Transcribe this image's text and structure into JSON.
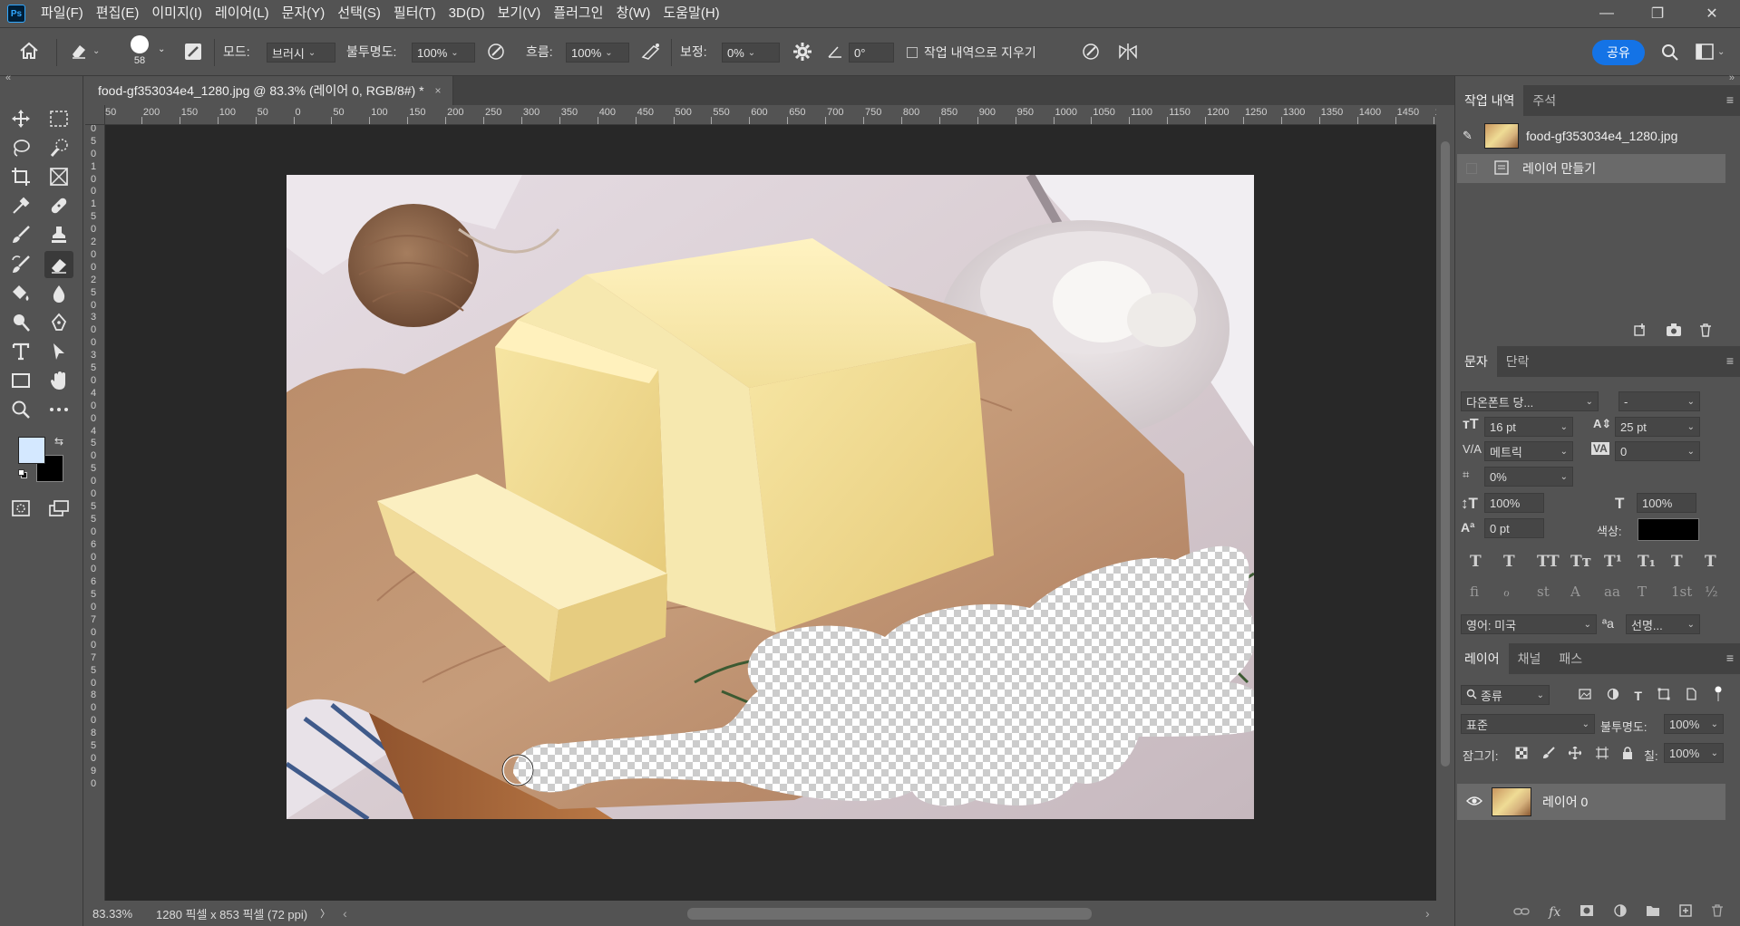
{
  "app": {
    "logo": "Ps"
  },
  "menu": [
    "파일(F)",
    "편집(E)",
    "이미지(I)",
    "레이어(L)",
    "문자(Y)",
    "선택(S)",
    "필터(T)",
    "3D(D)",
    "보기(V)",
    "플러그인",
    "창(W)",
    "도움말(H)"
  ],
  "window_controls": {
    "minimize": "—",
    "restore": "❐",
    "close": "✕"
  },
  "options": {
    "brush_size": "58",
    "mode_label": "모드:",
    "mode_value": "브러시",
    "opacity_label": "불투명도:",
    "opacity_value": "100%",
    "flow_label": "흐름:",
    "flow_value": "100%",
    "smoothing_label": "보정:",
    "smoothing_value": "0%",
    "angle_value": "0°",
    "erase_history_label": "작업 내역으로 지우기",
    "share_label": "공유"
  },
  "document": {
    "tab_title": "food-gf353034e4_1280.jpg @ 83.3% (레이어 0, RGB/8#) *",
    "close_glyph": "×"
  },
  "ruler": {
    "h_labels": [
      "50",
      "200",
      "150",
      "100",
      "50",
      "0",
      "50",
      "100",
      "150",
      "200",
      "250",
      "300",
      "350",
      "400",
      "450",
      "500",
      "550",
      "600",
      "650",
      "700",
      "750",
      "800",
      "850",
      "900",
      "950",
      "1000",
      "1050",
      "1100",
      "1150",
      "1200",
      "1250",
      "1300",
      "1350",
      "1400",
      "1450",
      "150"
    ],
    "v_labels": [
      "5",
      "0",
      "5",
      "0",
      "1",
      "0",
      "0",
      "1",
      "5",
      "0",
      "2",
      "0",
      "0",
      "2",
      "5",
      "0",
      "3",
      "0",
      "0",
      "3",
      "5",
      "0",
      "4",
      "0",
      "0",
      "4",
      "5",
      "0",
      "5",
      "0",
      "0",
      "5",
      "5",
      "0",
      "6",
      "0",
      "0",
      "6",
      "5",
      "0",
      "7",
      "0",
      "0",
      "7",
      "5",
      "0",
      "8",
      "0",
      "0",
      "8",
      "5",
      "0",
      "9",
      "0"
    ]
  },
  "status": {
    "zoom": "83.33%",
    "dimensions": "1280 픽셀 x 853 픽셀 (72 ppi)",
    "arrow": "〉",
    "scroll_left": "‹",
    "scroll_right": "›"
  },
  "history_panel": {
    "tabs": [
      "작업 내역",
      "주석"
    ],
    "items": [
      "food-gf353034e4_1280.jpg",
      "레이어 만들기"
    ]
  },
  "character_panel": {
    "tabs": [
      "문자",
      "단락"
    ],
    "font_family": "다온폰트 당...",
    "font_style": "-",
    "font_size": "16 pt",
    "leading": "25 pt",
    "kerning": "메트릭",
    "tracking": "0",
    "tsume": "0%",
    "vertical_scale": "100%",
    "horizontal_scale": "100%",
    "baseline_shift": "0 pt",
    "color_label": "색상:",
    "color_value": "#000000",
    "type_buttons": [
      "T",
      "T",
      "TT",
      "Tт",
      "T¹",
      "T₁",
      "T",
      "T"
    ],
    "opentype_buttons": [
      "ﬁ",
      "ℴ",
      "st",
      "A",
      "aa",
      "T",
      "1st",
      "½"
    ],
    "language": "영어: 미국",
    "aa_label": "ªa",
    "antialias": "선명..."
  },
  "layers_panel": {
    "tabs": [
      "레이어",
      "채널",
      "패스"
    ],
    "filter_kind": "종류",
    "blend_mode": "표준",
    "opacity_label": "불투명도:",
    "opacity_value": "100%",
    "lock_label": "잠그기:",
    "fill_label": "칠:",
    "fill_value": "100%",
    "layers": [
      "레이어 0"
    ]
  },
  "colors": {
    "foreground": "#d4e8ff",
    "background": "#000000",
    "accent": "#1473e6"
  }
}
